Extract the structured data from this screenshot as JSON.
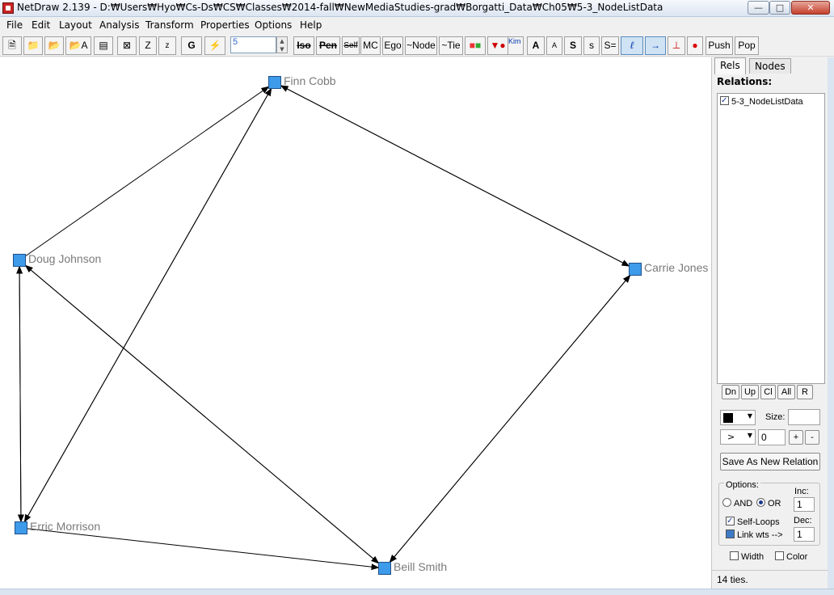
{
  "window": {
    "title": "NetDraw 2.139 - D:₩Users₩Hyo₩Cs-Ds₩CS₩Classes₩2014-fall₩NewMediaStudies-grad₩Borgatti_Data₩Ch05₩5-3_NodeListData"
  },
  "menu": [
    "File",
    "Edit",
    "Layout",
    "Analysis",
    "Transform",
    "Properties",
    "Options",
    "Help"
  ],
  "toolbar": {
    "z_upper": "Z",
    "z_lower": "z",
    "g": "G",
    "number_value": "5",
    "iso": "Iso",
    "pen": "Pen",
    "self": "Self",
    "mc": "MC",
    "ego": "Ego",
    "not_node": "~Node",
    "not_tie": "~Tie",
    "kim_bill": "Kim Bill",
    "font_a_big": "A",
    "font_a_small": "A",
    "size_s_big": "S",
    "size_s_small": "s",
    "size_s_eq": "S=",
    "push": "Push",
    "pop": "Pop"
  },
  "network": {
    "node_color": "#3d9be9",
    "nodes": [
      {
        "id": "finn",
        "label": "Finn Cobb"
      },
      {
        "id": "doug",
        "label": "Doug Johnson"
      },
      {
        "id": "carrie",
        "label": "Carrie Jones"
      },
      {
        "id": "erric",
        "label": "Erric Morrison"
      },
      {
        "id": "beill",
        "label": "Beill Smith"
      }
    ],
    "ties": [
      [
        "doug",
        "finn"
      ],
      [
        "finn",
        "carrie"
      ],
      [
        "carrie",
        "finn"
      ],
      [
        "erric",
        "finn"
      ],
      [
        "finn",
        "erric"
      ],
      [
        "doug",
        "erric"
      ],
      [
        "erric",
        "doug"
      ],
      [
        "doug",
        "beill"
      ],
      [
        "beill",
        "doug"
      ],
      [
        "erric",
        "beill"
      ],
      [
        "beill",
        "carrie"
      ],
      [
        "carrie",
        "beill"
      ]
    ]
  },
  "panel": {
    "tab_rels": "Rels",
    "tab_nodes": "Nodes",
    "relations_label": "Relations:",
    "relation_item": "5-3_NodeListData",
    "btn_dn": "Dn",
    "btn_up": "Up",
    "btn_cl": "Cl",
    "btn_all": "All",
    "btn_r": "R",
    "size_label": "Size:",
    "arrow_value": ">",
    "number_value": "0",
    "btn_plus": "+",
    "btn_minus": "-",
    "save_new_relation": "Save As New Relation",
    "options_label": "Options:",
    "and_label": "AND",
    "or_label": "OR",
    "inc_label": "Inc:",
    "inc_value": "1",
    "dec_label": "Dec:",
    "dec_value": "1",
    "self_loops": "Self-Loops",
    "link_wts": "Link wts -->",
    "width_label": "Width",
    "color_label": "Color",
    "status": "14 ties."
  }
}
